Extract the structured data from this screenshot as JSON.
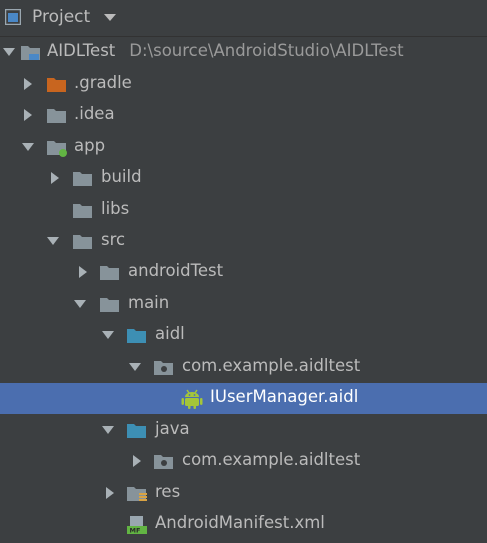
{
  "panel": {
    "title": "Project",
    "dropdown_icon": "chevron-down-icon"
  },
  "colors": {
    "background": "#3c3f41",
    "selection": "#4b6eaf",
    "folder": "#87939a",
    "source_folder": "#3d8fb4",
    "gradle_folder": "#c8651f",
    "android": "#a4c639"
  },
  "tree": {
    "root": {
      "label": "AIDLTest",
      "path": "D:\\source\\AndroidStudio\\AIDLTest",
      "icon": "module-folder-icon",
      "expanded": true
    },
    "gradle": {
      "label": ".gradle",
      "icon": "folder-orange-icon",
      "expanded": false
    },
    "idea": {
      "label": ".idea",
      "icon": "folder-icon",
      "expanded": false
    },
    "app": {
      "label": "app",
      "icon": "module-folder-icon",
      "expanded": true
    },
    "build": {
      "label": "build",
      "icon": "folder-icon",
      "expanded": false
    },
    "libs": {
      "label": "libs",
      "icon": "folder-icon"
    },
    "src": {
      "label": "src",
      "icon": "folder-icon",
      "expanded": true
    },
    "androidTest": {
      "label": "androidTest",
      "icon": "folder-icon",
      "expanded": false
    },
    "main": {
      "label": "main",
      "icon": "folder-icon",
      "expanded": true
    },
    "aidl": {
      "label": "aidl",
      "icon": "source-folder-icon",
      "expanded": true
    },
    "aidl_pkg": {
      "label": "com.example.aidltest",
      "icon": "package-icon",
      "expanded": true
    },
    "aidl_file": {
      "label": "IUserManager.aidl",
      "icon": "android-icon",
      "selected": true
    },
    "java": {
      "label": "java",
      "icon": "source-folder-icon",
      "expanded": true
    },
    "java_pkg": {
      "label": "com.example.aidltest",
      "icon": "package-icon",
      "expanded": false
    },
    "res": {
      "label": "res",
      "icon": "resource-folder-icon",
      "expanded": false
    },
    "manifest": {
      "label": "AndroidManifest.xml",
      "icon": "manifest-icon"
    }
  }
}
